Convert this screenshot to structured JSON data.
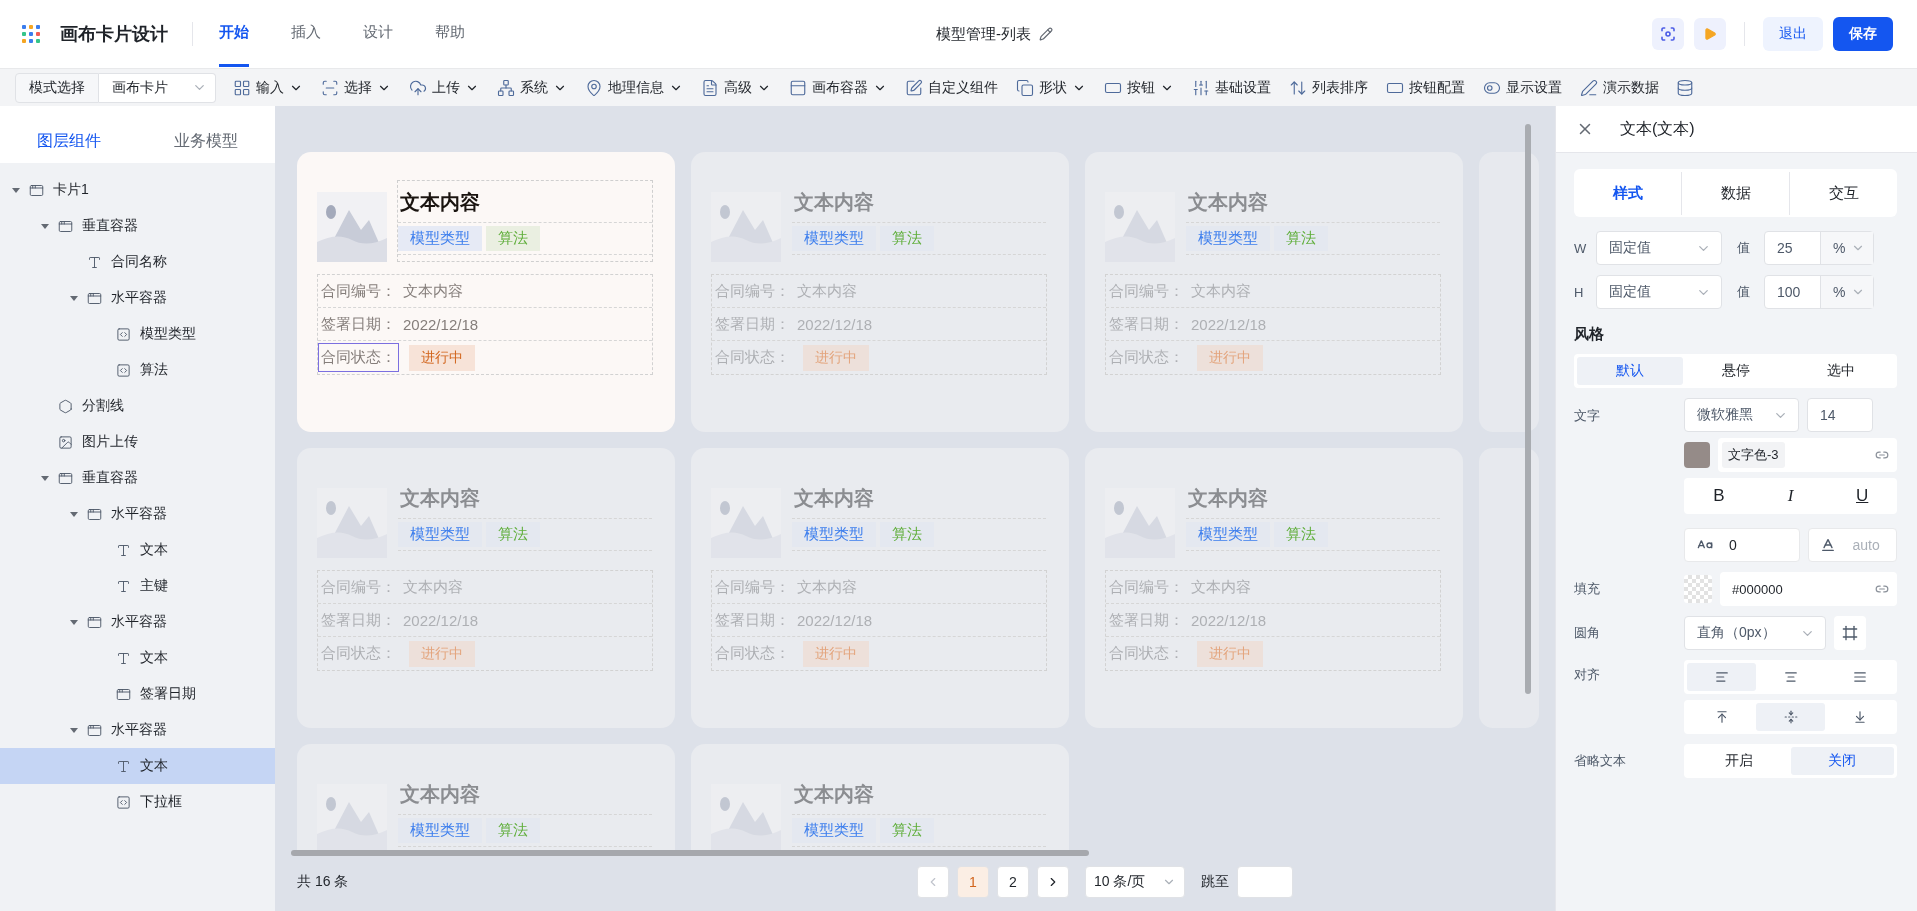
{
  "app": {
    "title": "画布卡片设计",
    "tabs": [
      {
        "label": "开始",
        "selected": true
      },
      {
        "label": "插入",
        "selected": false
      },
      {
        "label": "设计",
        "selected": false
      },
      {
        "label": "帮助",
        "selected": false
      }
    ],
    "doc_title": "模型管理-列表",
    "exit": "退出",
    "save": "保存"
  },
  "toolbar": {
    "mode_button": "模式选择",
    "mode_select": "画布卡片",
    "items": [
      {
        "label": "输入",
        "dropdown": true
      },
      {
        "label": "选择",
        "dropdown": true
      },
      {
        "label": "上传",
        "dropdown": true
      },
      {
        "label": "系统",
        "dropdown": true
      },
      {
        "label": "地理信息",
        "dropdown": true
      },
      {
        "label": "高级",
        "dropdown": true
      },
      {
        "label": "画布容器",
        "dropdown": true
      },
      {
        "label": "自定义组件",
        "dropdown": false
      },
      {
        "label": "形状",
        "dropdown": true
      },
      {
        "label": "按钮",
        "dropdown": true
      },
      {
        "label": "基础设置",
        "dropdown": false
      },
      {
        "label": "列表排序",
        "dropdown": false
      },
      {
        "label": "按钮配置",
        "dropdown": false
      },
      {
        "label": "显示设置",
        "dropdown": false
      },
      {
        "label": "演示数据",
        "dropdown": false
      }
    ]
  },
  "sidebar": {
    "tabs": [
      {
        "label": "图层组件",
        "selected": true
      },
      {
        "label": "业务模型",
        "selected": false
      }
    ],
    "tree": [
      {
        "label": "卡片1",
        "kind": "container",
        "selected": false,
        "expanded": true,
        "children": [
          {
            "label": "垂直容器",
            "kind": "container",
            "selected": false,
            "expanded": true,
            "children": [
              {
                "label": "合同名称",
                "kind": "text",
                "selected": false
              },
              {
                "label": "水平容器",
                "kind": "container",
                "selected": false,
                "expanded": true,
                "children": [
                  {
                    "label": "模型类型",
                    "kind": "field",
                    "selected": false
                  },
                  {
                    "label": "算法",
                    "kind": "field",
                    "selected": false
                  }
                ]
              }
            ]
          },
          {
            "label": "分割线",
            "kind": "divider",
            "selected": false
          },
          {
            "label": "图片上传",
            "kind": "image",
            "selected": false
          },
          {
            "label": "垂直容器",
            "kind": "container",
            "selected": false,
            "expanded": true,
            "children": [
              {
                "label": "水平容器",
                "kind": "container",
                "selected": false,
                "expanded": true,
                "children": [
                  {
                    "label": "文本",
                    "kind": "text",
                    "selected": false
                  },
                  {
                    "label": "主键",
                    "kind": "text",
                    "selected": false
                  }
                ]
              },
              {
                "label": "水平容器",
                "kind": "container",
                "selected": false,
                "expanded": true,
                "children": [
                  {
                    "label": "文本",
                    "kind": "text",
                    "selected": false
                  },
                  {
                    "label": "签署日期",
                    "kind": "container",
                    "selected": false
                  }
                ]
              },
              {
                "label": "水平容器",
                "kind": "container",
                "selected": false,
                "expanded": true,
                "children": [
                  {
                    "label": "文本",
                    "kind": "text",
                    "selected": true
                  },
                  {
                    "label": "下拉框",
                    "kind": "field",
                    "selected": false
                  }
                ]
              }
            ]
          }
        ]
      }
    ]
  },
  "cards": [
    {
      "selected": true,
      "title": "文本内容",
      "tags": [
        {
          "label": "模型类型",
          "color": "#3b7ded"
        },
        {
          "label": "算法",
          "color": "#5fae3a"
        }
      ],
      "fields": [
        {
          "label": "合同编号：",
          "value": "文本内容",
          "kind": "text",
          "selected": false
        },
        {
          "label": "签署日期：",
          "value": "2022/12/18",
          "kind": "text",
          "selected": false
        },
        {
          "label": "合同状态：",
          "value": "进行中",
          "kind": "status",
          "selected": true
        }
      ]
    },
    {
      "selected": false,
      "title": "文本内容",
      "tags": [
        {
          "label": "模型类型",
          "color": "#3b7ded"
        },
        {
          "label": "算法",
          "color": "#5fae3a"
        }
      ],
      "fields": [
        {
          "label": "合同编号：",
          "value": "文本内容",
          "kind": "text",
          "selected": false
        },
        {
          "label": "签署日期：",
          "value": "2022/12/18",
          "kind": "text",
          "selected": false
        },
        {
          "label": "合同状态：",
          "value": "进行中",
          "kind": "status",
          "selected": false
        }
      ]
    },
    {
      "selected": false,
      "title": "文本内容",
      "tags": [
        {
          "label": "模型类型",
          "color": "#3b7ded"
        },
        {
          "label": "算法",
          "color": "#5fae3a"
        }
      ],
      "fields": [
        {
          "label": "合同编号：",
          "value": "文本内容",
          "kind": "text",
          "selected": false
        },
        {
          "label": "签署日期：",
          "value": "2022/12/18",
          "kind": "text",
          "selected": false
        },
        {
          "label": "合同状态：",
          "value": "进行中",
          "kind": "status",
          "selected": false
        }
      ]
    },
    {
      "selected": false,
      "title": "文本内容",
      "tags": [
        {
          "label": "模型类型",
          "color": "#3b7ded"
        },
        {
          "label": "算法",
          "color": "#5fae3a"
        }
      ],
      "fields": [
        {
          "label": "合同编号：",
          "value": "文本内容",
          "kind": "text",
          "selected": false
        },
        {
          "label": "签署日期：",
          "value": "2022/12/18",
          "kind": "text",
          "selected": false
        },
        {
          "label": "合同状态：",
          "value": "进行中",
          "kind": "status",
          "selected": false
        }
      ]
    },
    {
      "selected": false,
      "title": "文本内容",
      "tags": [
        {
          "label": "模型类型",
          "color": "#3b7ded"
        },
        {
          "label": "算法",
          "color": "#5fae3a"
        }
      ],
      "fields": [
        {
          "label": "合同编号：",
          "value": "文本内容",
          "kind": "text",
          "selected": false
        },
        {
          "label": "签署日期：",
          "value": "2022/12/18",
          "kind": "text",
          "selected": false
        },
        {
          "label": "合同状态：",
          "value": "进行中",
          "kind": "status",
          "selected": false
        }
      ]
    },
    {
      "selected": false,
      "title": "文本内容",
      "tags": [
        {
          "label": "模型类型",
          "color": "#3b7ded"
        },
        {
          "label": "算法",
          "color": "#5fae3a"
        }
      ],
      "fields": [
        {
          "label": "合同编号：",
          "value": "文本内容",
          "kind": "text",
          "selected": false
        },
        {
          "label": "签署日期：",
          "value": "2022/12/18",
          "kind": "text",
          "selected": false
        },
        {
          "label": "合同状态：",
          "value": "进行中",
          "kind": "status",
          "selected": false
        }
      ]
    },
    {
      "selected": false,
      "title": "文本内容",
      "tags": [
        {
          "label": "模型类型",
          "color": "#3b7ded"
        },
        {
          "label": "算法",
          "color": "#5fae3a"
        }
      ]
    },
    {
      "selected": false,
      "title": "文本内容",
      "tags": [
        {
          "label": "模型类型",
          "color": "#3b7ded"
        },
        {
          "label": "算法",
          "color": "#5fae3a"
        }
      ]
    }
  ],
  "pagination": {
    "total": "共 16 条",
    "pages": [
      {
        "label": "1",
        "selected": true
      },
      {
        "label": "2",
        "selected": false
      }
    ],
    "prev_disabled": true,
    "page_size": "10 条/页",
    "jump": "跳至"
  },
  "panel": {
    "title": "文本(文本)",
    "tabs": [
      {
        "label": "样式",
        "selected": true
      },
      {
        "label": "数据",
        "selected": false
      },
      {
        "label": "交互",
        "selected": false
      }
    ],
    "size_rows": [
      {
        "axis": "W",
        "mode": "固定值",
        "value_label": "值",
        "value": "25",
        "unit": "%"
      },
      {
        "axis": "H",
        "mode": "固定值",
        "value_label": "值",
        "value": "100",
        "unit": "%"
      }
    ],
    "style_heading": "风格",
    "states": [
      {
        "label": "默认",
        "selected": true
      },
      {
        "label": "悬停",
        "selected": false
      },
      {
        "label": "选中",
        "selected": false
      }
    ],
    "text_label": "文字",
    "font": "微软雅黑",
    "font_size": "14",
    "text_color": {
      "name": "文字色-3",
      "color": "#958b88"
    },
    "format": [
      {
        "label": "B",
        "kind": "bold",
        "on": false
      },
      {
        "label": "I",
        "kind": "italic",
        "on": false
      },
      {
        "label": "U",
        "kind": "underline",
        "on": false
      }
    ],
    "letter_spacing": "0",
    "line_height_placeholder": "auto",
    "fill_label": "填充",
    "fill": "#000000",
    "radius_label": "圆角",
    "radius": "直角（0px）",
    "align_label": "对齐",
    "h_align": [
      {
        "kind": "left",
        "selected": true
      },
      {
        "kind": "center",
        "selected": false
      },
      {
        "kind": "justify",
        "selected": false
      }
    ],
    "v_align": [
      {
        "kind": "top",
        "selected": false
      },
      {
        "kind": "middle",
        "selected": true
      },
      {
        "kind": "bottom",
        "selected": false
      }
    ],
    "ellipsis_label": "省略文本",
    "ellipsis": [
      {
        "label": "开启",
        "selected": false
      },
      {
        "label": "关闭",
        "selected": true
      }
    ]
  }
}
